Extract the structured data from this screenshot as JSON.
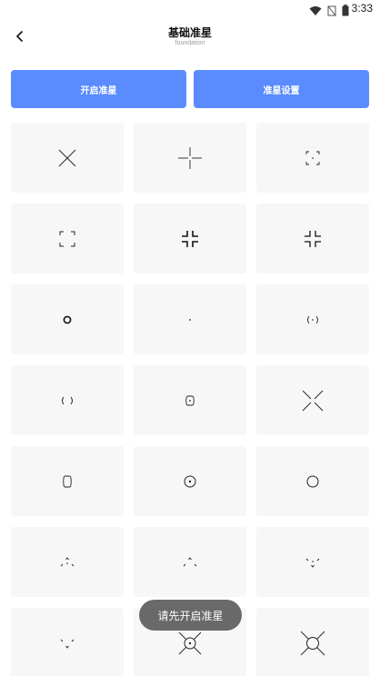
{
  "status_bar": {
    "time": "3:33",
    "icons": [
      "wifi-icon",
      "signal-off-icon",
      "battery-icon"
    ]
  },
  "header": {
    "title": "基础准星",
    "subtitle": "foundation",
    "back_icon": "chevron-left-icon"
  },
  "actions": {
    "open_label": "开启准星",
    "settings_label": "准星设置",
    "accent_color": "#5b8cff"
  },
  "crosshairs": [
    {
      "icon": "diagonal-cross-crosshair-icon"
    },
    {
      "icon": "plus-crosshair-icon"
    },
    {
      "icon": "small-corner-brackets-dot-crosshair-icon"
    },
    {
      "icon": "corner-brackets-crosshair-icon"
    },
    {
      "icon": "inward-corners-bold-crosshair-icon"
    },
    {
      "icon": "inward-corners-crosshair-icon"
    },
    {
      "icon": "circle-crosshair-icon"
    },
    {
      "icon": "dot-crosshair-icon"
    },
    {
      "icon": "parentheses-dot-crosshair-icon"
    },
    {
      "icon": "parentheses-crosshair-icon"
    },
    {
      "icon": "bracket-dot-crosshair-icon"
    },
    {
      "icon": "x-gap-crosshair-icon"
    },
    {
      "icon": "vertical-brackets-crosshair-icon"
    },
    {
      "icon": "circle-dot-crosshair-icon"
    },
    {
      "icon": "thin-circle-crosshair-icon"
    },
    {
      "icon": "chevron-up-dot-crosshair-icon"
    },
    {
      "icon": "chevron-up-crosshair-icon"
    },
    {
      "icon": "chevron-down-dot-crosshair-icon"
    },
    {
      "icon": "chevron-down-crosshair-icon"
    },
    {
      "icon": "x-circle-dot-crosshair-icon"
    },
    {
      "icon": "x-circle-crosshair-icon"
    }
  ],
  "toast": {
    "text": "请先开启准星"
  }
}
